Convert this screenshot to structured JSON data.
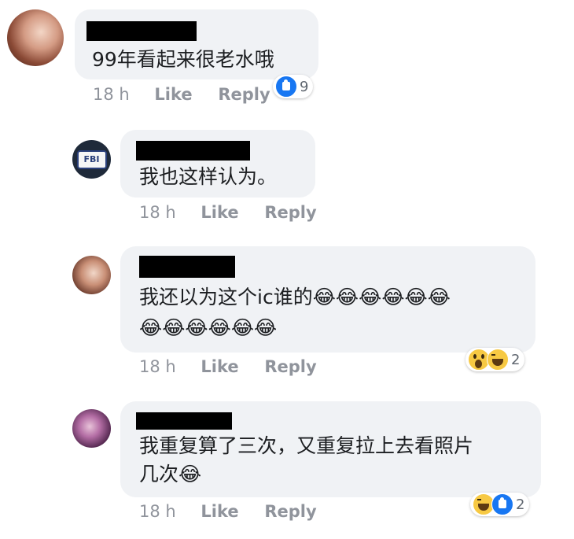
{
  "comments": [
    {
      "text_lines": [
        "99年看起来很老水哦"
      ],
      "time": "18 h",
      "like_label": "Like",
      "reply_label": "Reply",
      "reactions": {
        "icons": [
          "like-icon"
        ],
        "count": "9"
      }
    },
    {
      "text_lines": [
        "我也这样认为。"
      ],
      "avatar_badge": "FBI",
      "time": "18 h",
      "like_label": "Like",
      "reply_label": "Reply"
    },
    {
      "text_lines": [
        "我还以为这个ic谁的😂😂😂😂😂😂",
        "😂😂😂😂😂😂"
      ],
      "time": "18 h",
      "like_label": "Like",
      "reply_label": "Reply",
      "reactions": {
        "icons": [
          "wow-icon",
          "haha-icon"
        ],
        "count": "2"
      }
    },
    {
      "text_lines": [
        "我重复算了三次，又重复拉上去看照片",
        "几次😂"
      ],
      "time": "18 h",
      "like_label": "Like",
      "reply_label": "Reply",
      "reactions": {
        "icons": [
          "haha-icon",
          "like-icon"
        ],
        "count": "2"
      }
    }
  ],
  "colors": {
    "bubble": "#f0f2f5",
    "meta_text": "#90949c",
    "like_blue": "#1877f2",
    "emoji_yellow": "#f7c943"
  }
}
